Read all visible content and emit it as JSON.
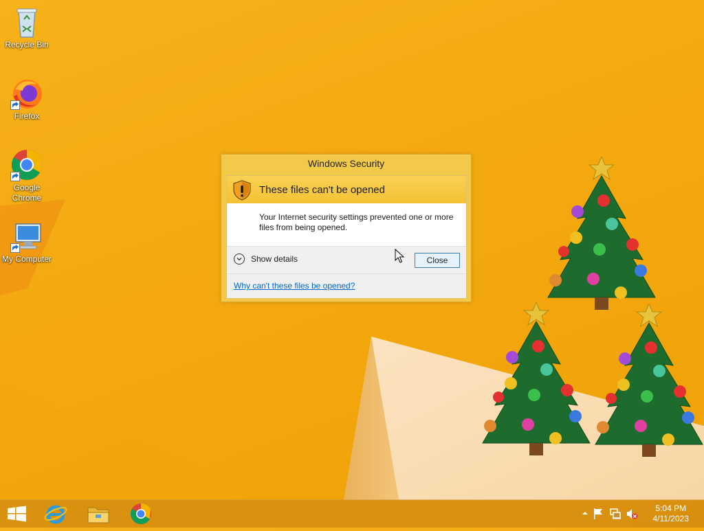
{
  "desktop": {
    "icons": [
      {
        "label": "Recycle Bin"
      },
      {
        "label": "Firefox"
      },
      {
        "label": "Google Chrome"
      },
      {
        "label": "My Computer"
      }
    ]
  },
  "dialog": {
    "title": "Windows Security",
    "heading": "These files can't be opened",
    "message": "Your Internet security settings prevented one or more files from being opened.",
    "show_details_label": "Show details",
    "close_label": "Close",
    "help_link": "Why can't these files be opened?"
  },
  "taskbar": {
    "pinned": [
      "start-icon",
      "internet-explorer-icon",
      "file-explorer-icon",
      "chrome-icon"
    ],
    "clock": {
      "time": "5:04 PM",
      "date": "4/11/2023"
    },
    "tray": [
      "show-hidden-icons",
      "action-center-flag-icon",
      "network-icon",
      "volume-muted-icon"
    ]
  },
  "colors": {
    "wallpaper": "#f3a90f",
    "dialog_frame": "#f3c94a",
    "link": "#0066cc",
    "button_border": "#3c7fb1"
  }
}
